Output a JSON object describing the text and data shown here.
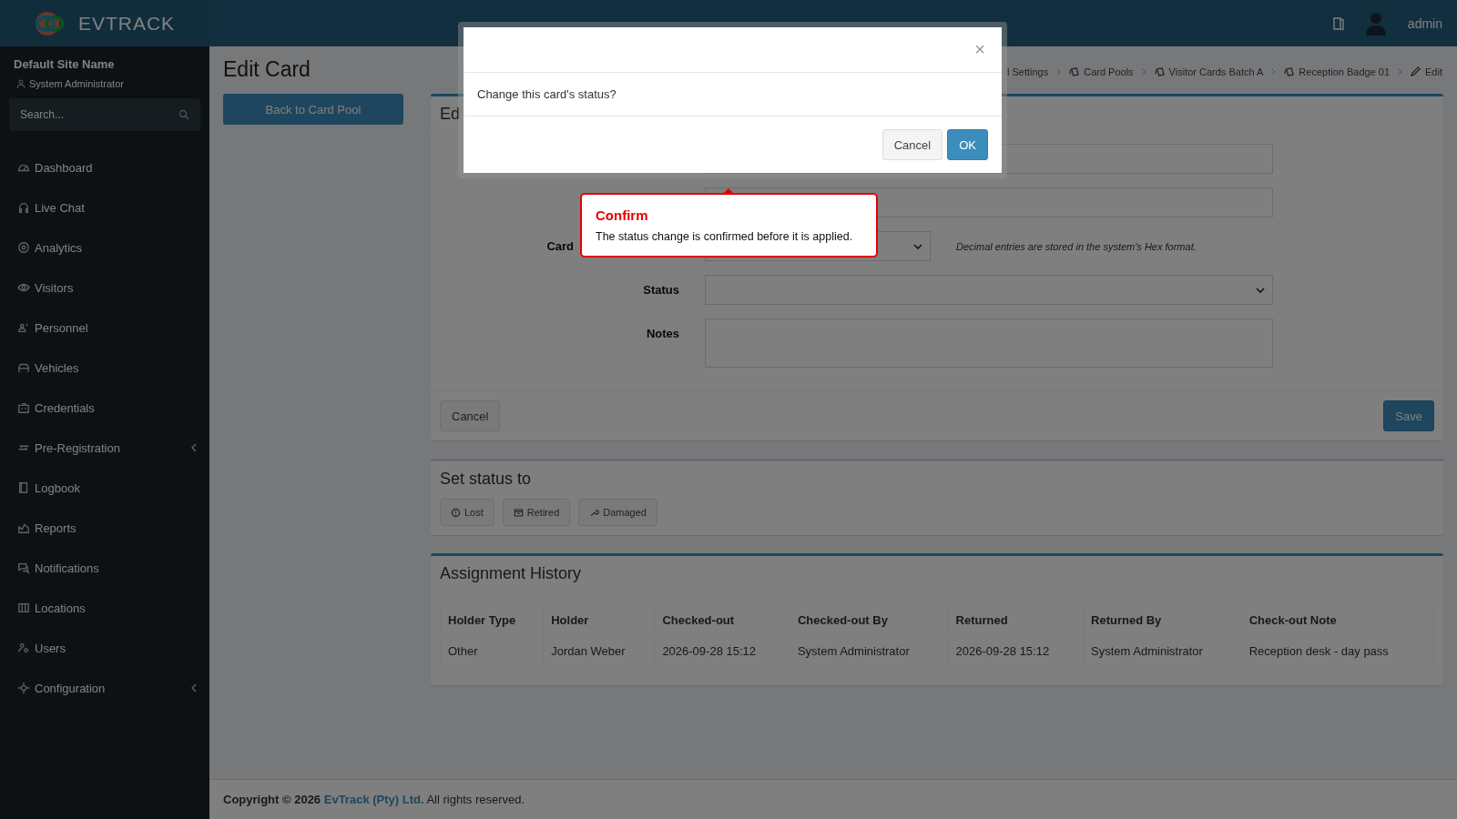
{
  "header": {
    "logo": "**EV**TRACK",
    "user_name": "admin"
  },
  "sidebar": {
    "site_name": "Default Site Name",
    "user_role": "System Administrator",
    "search": {
      "placeholder": "Search..."
    },
    "items": [
      {
        "label": "Dashboard",
        "expandable": false
      },
      {
        "label": "Live Chat",
        "expandable": false
      },
      {
        "label": "Analytics",
        "expandable": false
      },
      {
        "label": "Visitors",
        "expandable": false
      },
      {
        "label": "Personnel",
        "expandable": false
      },
      {
        "label": "Vehicles",
        "expandable": false
      },
      {
        "label": "Credentials",
        "expandable": false
      },
      {
        "label": "Pre-Registration",
        "expandable": true
      },
      {
        "label": "Logbook",
        "expandable": false
      },
      {
        "label": "Reports",
        "expandable": false
      },
      {
        "label": "Notifications",
        "expandable": false
      },
      {
        "label": "Locations",
        "expandable": false
      },
      {
        "label": "Users",
        "expandable": false
      },
      {
        "label": "Configuration",
        "expandable": true
      }
    ]
  },
  "page_title": "Edit Card",
  "back_button": "Back to Card Pool",
  "breadcrumb": [
    {
      "label": "l Settings",
      "kind": "plain"
    },
    {
      "label": "Card Pools",
      "kind": "card"
    },
    {
      "label": "Visitor Cards Batch A",
      "kind": "card"
    },
    {
      "label": "Reception Badge 01",
      "kind": "card"
    },
    {
      "label": "Edit",
      "kind": "edit"
    }
  ],
  "form": {
    "title": "Ed",
    "fields": [
      {
        "kind": "input"
      },
      {
        "kind": "input"
      },
      {
        "kind": "short-select",
        "label": "Card",
        "hint": "Decimal entries are stored in the system's Hex format."
      },
      {
        "kind": "select",
        "label": "Status"
      },
      {
        "kind": "textarea",
        "label": "Notes"
      }
    ],
    "cancel": "Cancel",
    "save": "Save"
  },
  "status_actions": {
    "title": "Set status to",
    "buttons": [
      "Lost",
      "Retired",
      "Damaged"
    ]
  },
  "history": {
    "title": "Assignment History",
    "columns": [
      "Holder Type",
      "Holder",
      "Checked-out",
      "Checked-out By",
      "Returned",
      "Returned By",
      "Check-out Note"
    ],
    "rows": [
      [
        "Other",
        "Jordan Weber",
        "2026-09-28 15:12",
        "System Administrator",
        "2026-09-28 15:12",
        "System Administrator",
        "Reception desk - day pass"
      ]
    ]
  },
  "footer": {
    "prefix": "Copyright © 2026",
    "company": "EvTrack (Pty) Ltd.",
    "suffix": "All rights reserved."
  },
  "modal": {
    "close": "×",
    "message": "Change this card's status?",
    "cancel": "Cancel",
    "ok": "OK"
  },
  "tooltip": {
    "title": "Confirm",
    "text": "The status change is confirmed before it is applied."
  }
}
